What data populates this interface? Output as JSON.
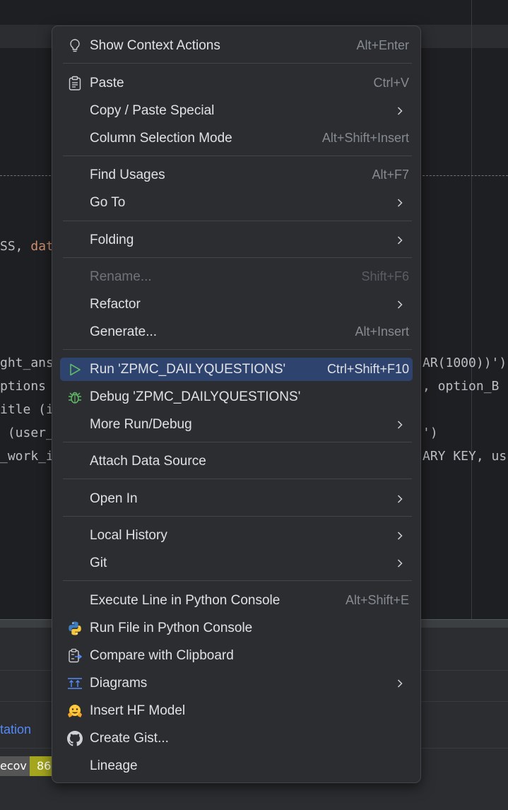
{
  "background": {
    "code_lines": [
      {
        "text": "SS, ",
        "accent": "dat"
      },
      {
        "text": "ght_ans"
      },
      {
        "text": "ptions"
      },
      {
        "text": "itle (i"
      },
      {
        "text": " (user_"
      },
      {
        "text": "_work_i"
      }
    ],
    "code_right": [
      "AR(1000))')",
      ", option_B",
      "')",
      "ARY KEY, us"
    ],
    "bottom_link": "tation",
    "badge_left": "ecov",
    "badge_right": "86"
  },
  "menu": {
    "items": [
      {
        "label": "Show Context Actions",
        "shortcut": "Alt+Enter",
        "icon": "lightbulb-icon"
      },
      {
        "label": "Paste",
        "shortcut": "Ctrl+V",
        "icon": "clipboard-icon"
      },
      {
        "label": "Copy / Paste Special",
        "submenu": true
      },
      {
        "label": "Column Selection Mode",
        "shortcut": "Alt+Shift+Insert"
      },
      {
        "label": "Find Usages",
        "shortcut": "Alt+F7"
      },
      {
        "label": "Go To",
        "submenu": true
      },
      {
        "label": "Folding",
        "submenu": true
      },
      {
        "label": "Rename...",
        "shortcut": "Shift+F6",
        "disabled": true
      },
      {
        "label": "Refactor",
        "submenu": true
      },
      {
        "label": "Generate...",
        "shortcut": "Alt+Insert"
      },
      {
        "label": "Run 'ZPMC_DAILYQUESTIONS'",
        "shortcut": "Ctrl+Shift+F10",
        "icon": "run-icon",
        "selected": true
      },
      {
        "label": "Debug 'ZPMC_DAILYQUESTIONS'",
        "icon": "debug-bug-icon"
      },
      {
        "label": "More Run/Debug",
        "submenu": true
      },
      {
        "label": "Attach Data Source"
      },
      {
        "label": "Open In",
        "submenu": true
      },
      {
        "label": "Local History",
        "submenu": true
      },
      {
        "label": "Git",
        "submenu": true
      },
      {
        "label": "Execute Line in Python Console",
        "shortcut": "Alt+Shift+E"
      },
      {
        "label": "Run File in Python Console",
        "icon": "python-icon"
      },
      {
        "label": "Compare with Clipboard",
        "icon": "compare-clipboard-icon"
      },
      {
        "label": "Diagrams",
        "submenu": true,
        "icon": "diagrams-icon"
      },
      {
        "label": "Insert HF Model",
        "icon": "hugging-face-icon"
      },
      {
        "label": "Create Gist...",
        "icon": "github-icon"
      },
      {
        "label": "Lineage"
      }
    ]
  },
  "colors": {
    "menu_bg": "#2b2d30",
    "selection": "#2e436e",
    "text": "#dfe1e5",
    "shortcut": "#868a91",
    "run_green": "#5fb865"
  }
}
